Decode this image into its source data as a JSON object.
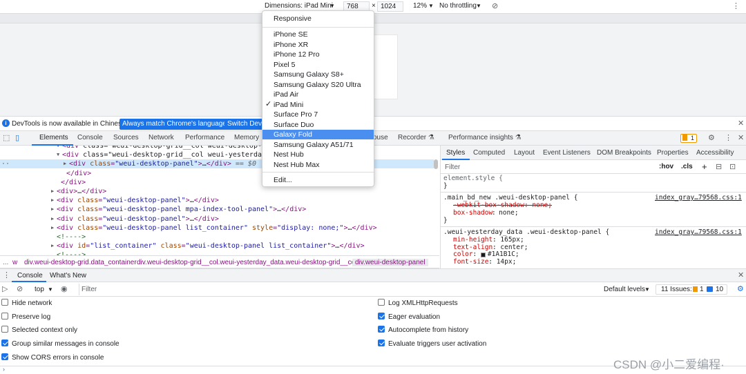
{
  "device_toolbar": {
    "dimensions_label": "Dimensions: iPad Mini",
    "width": "768",
    "times": "×",
    "height": "1024",
    "zoom": "12%",
    "throttling": "No throttling"
  },
  "device_menu": {
    "items": [
      "Responsive",
      "iPhone SE",
      "iPhone XR",
      "iPhone 12 Pro",
      "Pixel 5",
      "Samsung Galaxy S8+",
      "Samsung Galaxy S20 Ultra",
      "iPad Air",
      "iPad Mini",
      "Surface Pro 7",
      "Surface Duo",
      "Galaxy Fold",
      "Samsung Galaxy A51/71",
      "Nest Hub",
      "Nest Hub Max",
      "Edit..."
    ],
    "checked": "iPad Mini",
    "highlighted": "Galaxy Fold"
  },
  "infobar": {
    "message": "DevTools is now available in Chinese!",
    "match_button": "Always match Chrome's language",
    "switch_button": "Switch DevT"
  },
  "main_tabs": [
    "Elements",
    "Console",
    "Sources",
    "Network",
    "Performance",
    "Memory",
    "Lighthouse",
    "Recorder",
    "Performance insights"
  ],
  "main_tabs_display": {
    "lighthouse_fragment": "ouse",
    "recorder": "Recorder ⚗",
    "perf_insights": "Performance insights ⚗"
  },
  "issues_badge": "1",
  "elements": {
    "lines": [
      {
        "indent": 90,
        "html": "<div class=\"weui-desktop-grid__col weui-desktop-grid"
      },
      {
        "indent": 90,
        "html": "<div class=\"weui-desktop-grid__col weui-yesterday_da"
      },
      {
        "indent": 100,
        "html": "<div class=\"weui-desktop-panel\">…</div> == $0"
      },
      {
        "indent": 96,
        "html": "</div>"
      },
      {
        "indent": 88,
        "html": "</div>"
      },
      {
        "indent": 82,
        "html": "<div>…</div>"
      },
      {
        "indent": 82,
        "html": "<div class=\"weui-desktop-panel\">…</div>"
      },
      {
        "indent": 82,
        "html": "<div class=\"weui-desktop-panel mpa-index-tool-panel\">…</div>"
      },
      {
        "indent": 82,
        "html": "<div class=\"weui-desktop-panel\">…</div>"
      },
      {
        "indent": 82,
        "html": "<div class=\"weui-desktop-panel list_container\" style=\"display: none;\">…</div>"
      },
      {
        "indent": 82,
        "html": "<!---->"
      },
      {
        "indent": 82,
        "html": "<div id=\"list_container\" class=\"weui-desktop-panel list_container\">…</div>"
      },
      {
        "indent": 82,
        "html": "<!---->"
      }
    ],
    "selected_index": 2,
    "row_dots": "··"
  },
  "breadcrumbs": [
    "...",
    "w",
    "div.weui-desktop-grid.data_container",
    "div.weui-desktop-grid__col.weui-yesterday_data.weui-desktop-grid__col_8",
    "div.weui-desktop-panel"
  ],
  "styles_tabs": [
    "Styles",
    "Computed",
    "Layout",
    "Event Listeners",
    "DOM Breakpoints",
    "Properties",
    "Accessibility"
  ],
  "styles_filter": {
    "placeholder": "Filter",
    "hov": ":hov",
    "cls": ".cls",
    "plus": "+"
  },
  "styles": {
    "element_style": "element.style {",
    "close": "}",
    "rule1_selector": ".main_bd_new .weui-desktop-panel {",
    "rule1_source": "index_gray…79568.css:1",
    "rule1_prop1": "-webkit-box-shadow: none;",
    "rule1_prop2_name": "box-shadow",
    "rule1_prop2_val": "none;",
    "rule2_selector": ".weui-yesterday_data .weui-desktop-panel {",
    "rule2_source": "index_gray…79568.css:1",
    "rule2_props": [
      {
        "name": "min-height",
        "val": "165px;"
      },
      {
        "name": "text-align",
        "val": "center;"
      },
      {
        "name": "color",
        "val": "#1A1B1C;"
      },
      {
        "name": "font-size",
        "val": "14px;"
      }
    ]
  },
  "drawer_tabs": [
    "Console",
    "What's New"
  ],
  "console_bar": {
    "context": "top",
    "filter_placeholder": "Filter",
    "levels": "Default levels",
    "issues": "11 Issues:",
    "issues_warn": "1",
    "issues_info": "10"
  },
  "console_settings": {
    "left": [
      {
        "label": "Hide network",
        "checked": false
      },
      {
        "label": "Preserve log",
        "checked": false
      },
      {
        "label": "Selected context only",
        "checked": false
      },
      {
        "label": "Group similar messages in console",
        "checked": true
      },
      {
        "label": "Show CORS errors in console",
        "checked": true
      }
    ],
    "right": [
      {
        "label": "Log XMLHttpRequests",
        "checked": false
      },
      {
        "label": "Eager evaluation",
        "checked": true
      },
      {
        "label": "Autocomplete from history",
        "checked": true
      },
      {
        "label": "Evaluate triggers user activation",
        "checked": true
      }
    ]
  },
  "watermark": "CSDN @小二爱编程·",
  "colors": {
    "accent": "#1a73e8",
    "menu_highlight": "#4a8ff0",
    "tag": "#881280"
  }
}
